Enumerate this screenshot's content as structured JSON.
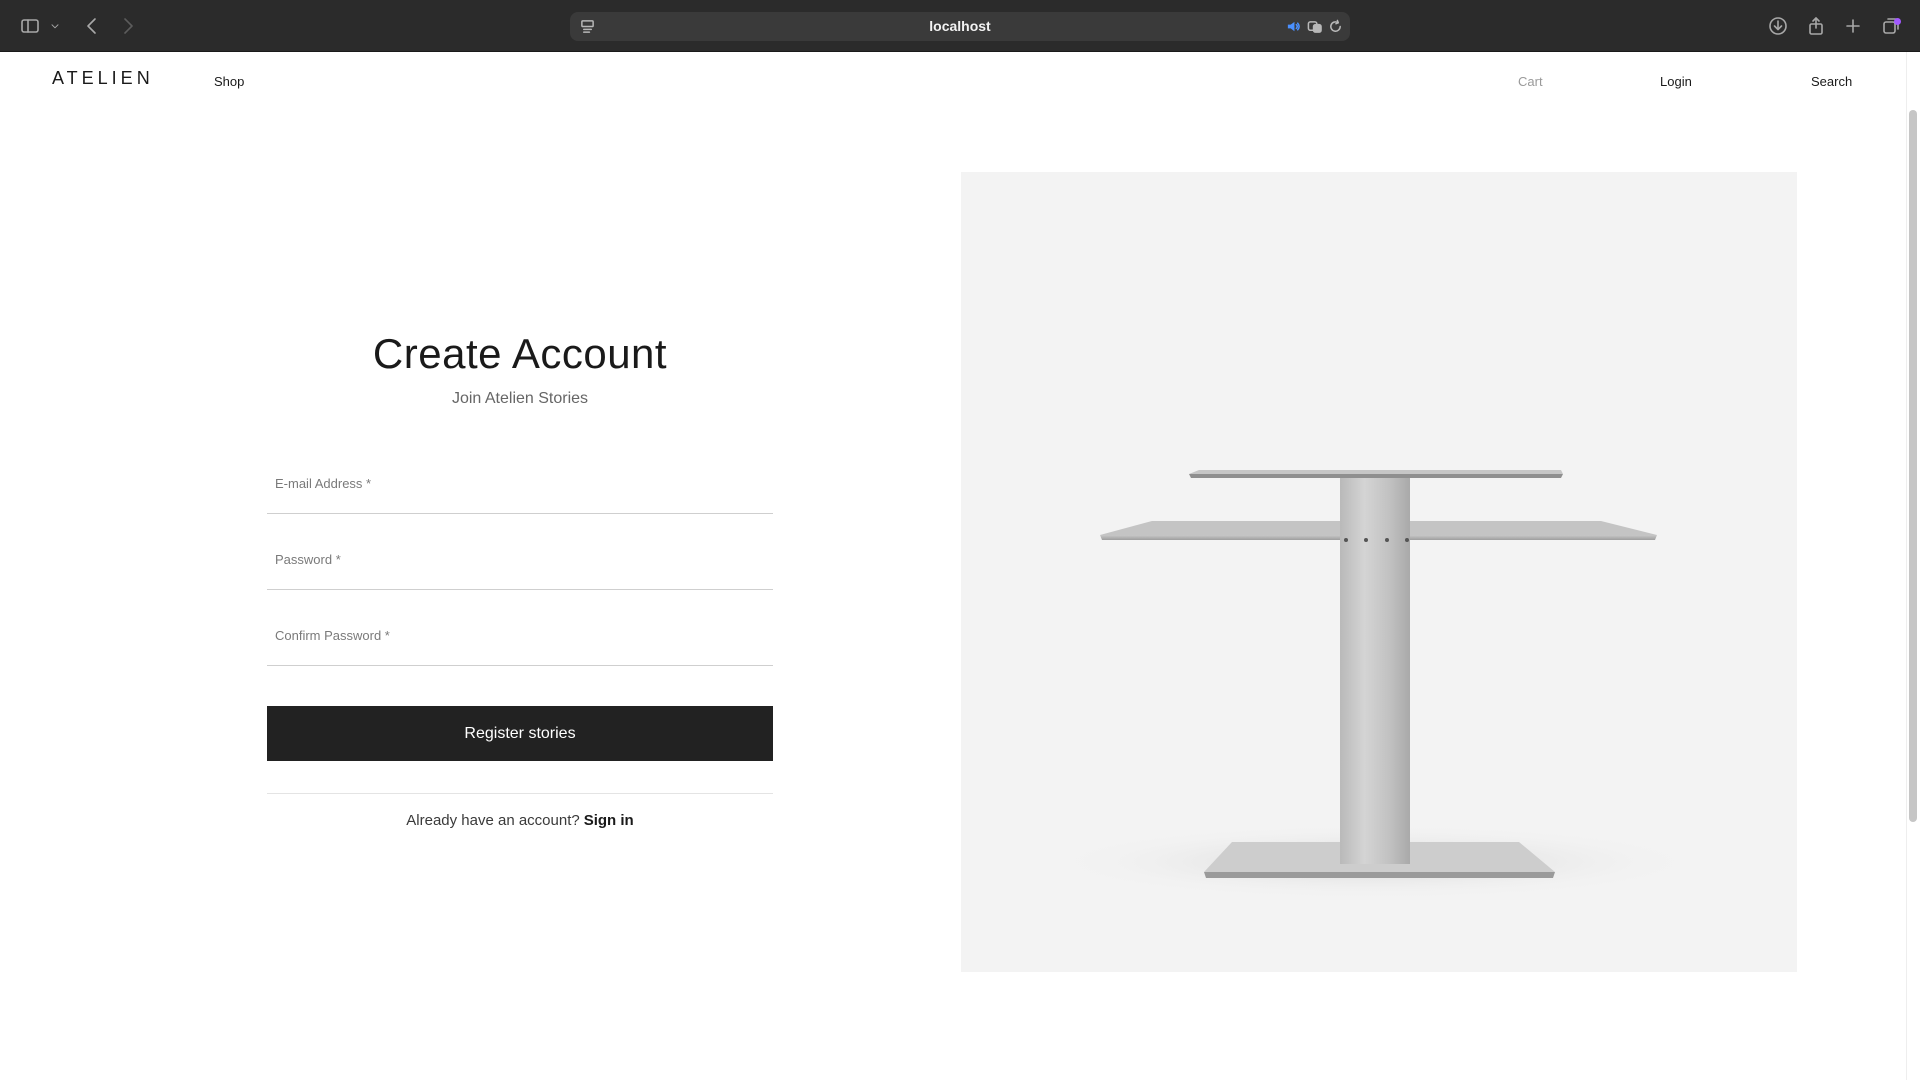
{
  "browser": {
    "url": "localhost"
  },
  "header": {
    "logo": "ATELIEN",
    "nav": {
      "shop": "Shop",
      "cart": "Cart",
      "login": "Login",
      "search": "Search"
    }
  },
  "form": {
    "title": "Create Account",
    "subtitle": "Join Atelien Stories",
    "email_placeholder": "E-mail Address *",
    "password_placeholder": "Password *",
    "confirm_placeholder": "Confirm Password *",
    "submit_label": "Register stories",
    "signin_prompt": "Already have an account?",
    "signin_link": "Sign in"
  },
  "colors": {
    "chrome_bg": "#2b2b2b",
    "button_bg": "#222222",
    "image_bg": "#f3f3f3"
  }
}
